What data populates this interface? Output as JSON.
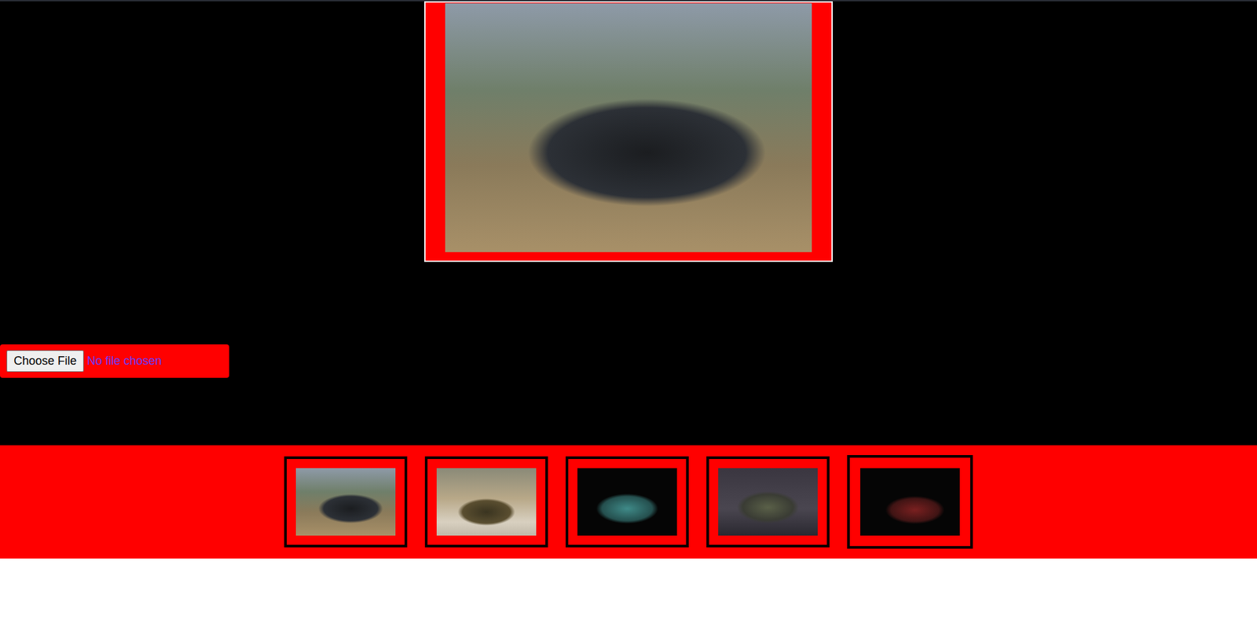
{
  "upload": {
    "button": "Choose File",
    "status": "No file chosen"
  },
  "gallery": {
    "thumbnails": [
      {
        "selected": true
      },
      {
        "selected": false
      },
      {
        "selected": false
      },
      {
        "selected": false
      },
      {
        "selected": false
      }
    ]
  }
}
